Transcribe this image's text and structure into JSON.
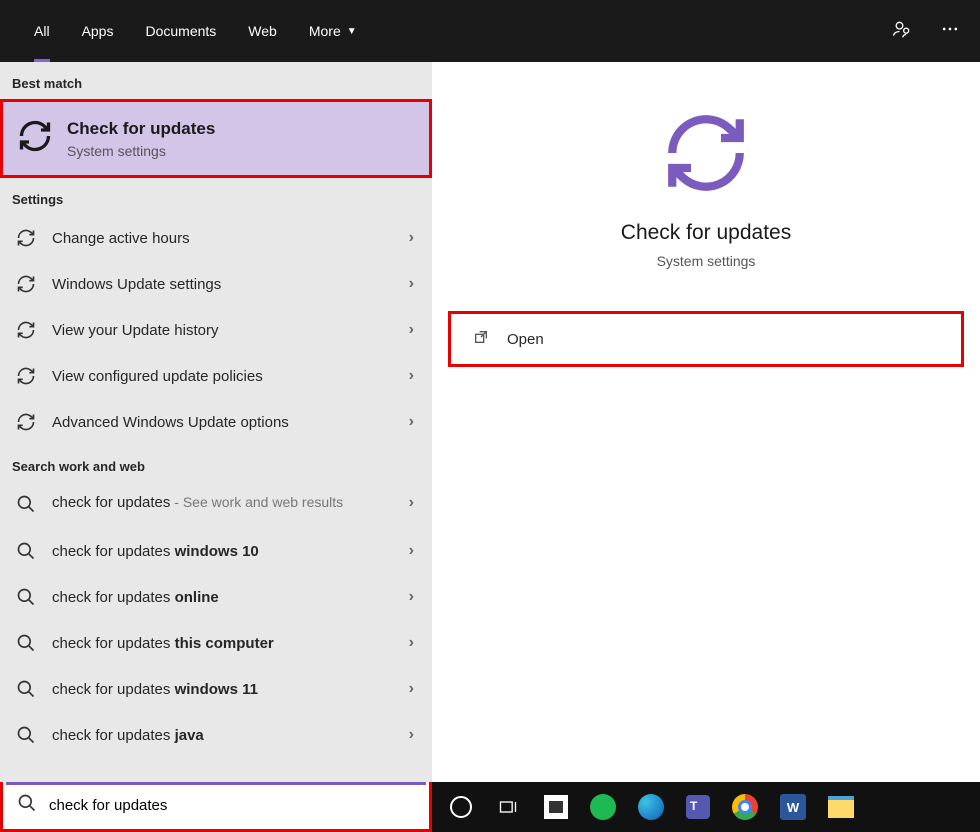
{
  "topbar": {
    "tabs": [
      "All",
      "Apps",
      "Documents",
      "Web",
      "More"
    ]
  },
  "groups": {
    "bestmatch_label": "Best match",
    "settings_label": "Settings",
    "searchweb_label": "Search work and web"
  },
  "bestmatch": {
    "title": "Check for updates",
    "subtitle": "System settings"
  },
  "settings_items": [
    {
      "label": "Change active hours"
    },
    {
      "label": "Windows Update settings"
    },
    {
      "label": "View your Update history"
    },
    {
      "label": "View configured update policies"
    },
    {
      "label": "Advanced Windows Update options"
    }
  ],
  "web_items": [
    {
      "prefix": "check for updates",
      "bold": "",
      "suffix": " - See work and web results"
    },
    {
      "prefix": "check for updates ",
      "bold": "windows 10",
      "suffix": ""
    },
    {
      "prefix": "check for updates ",
      "bold": "online",
      "suffix": ""
    },
    {
      "prefix": "check for updates ",
      "bold": "this computer",
      "suffix": ""
    },
    {
      "prefix": "check for updates ",
      "bold": "windows 11",
      "suffix": ""
    },
    {
      "prefix": "check for updates ",
      "bold": "java",
      "suffix": ""
    }
  ],
  "preview": {
    "title": "Check for updates",
    "subtitle": "System settings",
    "action": "Open"
  },
  "searchbox": {
    "value": "check for updates"
  }
}
